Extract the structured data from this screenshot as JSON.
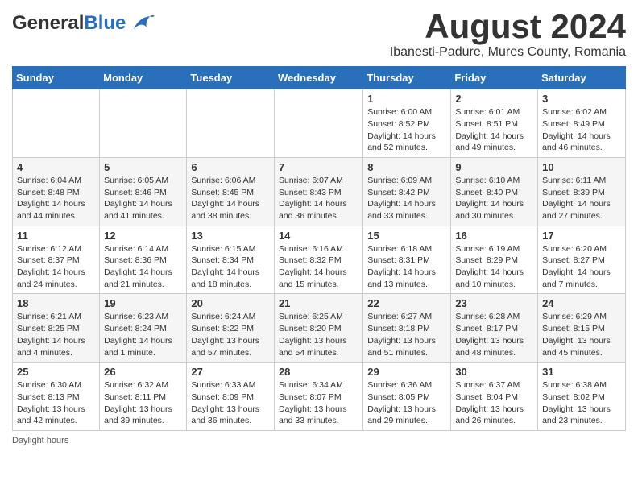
{
  "header": {
    "logo_general": "General",
    "logo_blue": "Blue",
    "month_year": "August 2024",
    "location": "Ibanesti-Padure, Mures County, Romania"
  },
  "days_of_week": [
    "Sunday",
    "Monday",
    "Tuesday",
    "Wednesday",
    "Thursday",
    "Friday",
    "Saturday"
  ],
  "weeks": [
    [
      {
        "date": "",
        "info": ""
      },
      {
        "date": "",
        "info": ""
      },
      {
        "date": "",
        "info": ""
      },
      {
        "date": "",
        "info": ""
      },
      {
        "date": "1",
        "info": "Sunrise: 6:00 AM\nSunset: 8:52 PM\nDaylight: 14 hours and 52 minutes."
      },
      {
        "date": "2",
        "info": "Sunrise: 6:01 AM\nSunset: 8:51 PM\nDaylight: 14 hours and 49 minutes."
      },
      {
        "date": "3",
        "info": "Sunrise: 6:02 AM\nSunset: 8:49 PM\nDaylight: 14 hours and 46 minutes."
      }
    ],
    [
      {
        "date": "4",
        "info": "Sunrise: 6:04 AM\nSunset: 8:48 PM\nDaylight: 14 hours and 44 minutes."
      },
      {
        "date": "5",
        "info": "Sunrise: 6:05 AM\nSunset: 8:46 PM\nDaylight: 14 hours and 41 minutes."
      },
      {
        "date": "6",
        "info": "Sunrise: 6:06 AM\nSunset: 8:45 PM\nDaylight: 14 hours and 38 minutes."
      },
      {
        "date": "7",
        "info": "Sunrise: 6:07 AM\nSunset: 8:43 PM\nDaylight: 14 hours and 36 minutes."
      },
      {
        "date": "8",
        "info": "Sunrise: 6:09 AM\nSunset: 8:42 PM\nDaylight: 14 hours and 33 minutes."
      },
      {
        "date": "9",
        "info": "Sunrise: 6:10 AM\nSunset: 8:40 PM\nDaylight: 14 hours and 30 minutes."
      },
      {
        "date": "10",
        "info": "Sunrise: 6:11 AM\nSunset: 8:39 PM\nDaylight: 14 hours and 27 minutes."
      }
    ],
    [
      {
        "date": "11",
        "info": "Sunrise: 6:12 AM\nSunset: 8:37 PM\nDaylight: 14 hours and 24 minutes."
      },
      {
        "date": "12",
        "info": "Sunrise: 6:14 AM\nSunset: 8:36 PM\nDaylight: 14 hours and 21 minutes."
      },
      {
        "date": "13",
        "info": "Sunrise: 6:15 AM\nSunset: 8:34 PM\nDaylight: 14 hours and 18 minutes."
      },
      {
        "date": "14",
        "info": "Sunrise: 6:16 AM\nSunset: 8:32 PM\nDaylight: 14 hours and 15 minutes."
      },
      {
        "date": "15",
        "info": "Sunrise: 6:18 AM\nSunset: 8:31 PM\nDaylight: 14 hours and 13 minutes."
      },
      {
        "date": "16",
        "info": "Sunrise: 6:19 AM\nSunset: 8:29 PM\nDaylight: 14 hours and 10 minutes."
      },
      {
        "date": "17",
        "info": "Sunrise: 6:20 AM\nSunset: 8:27 PM\nDaylight: 14 hours and 7 minutes."
      }
    ],
    [
      {
        "date": "18",
        "info": "Sunrise: 6:21 AM\nSunset: 8:25 PM\nDaylight: 14 hours and 4 minutes."
      },
      {
        "date": "19",
        "info": "Sunrise: 6:23 AM\nSunset: 8:24 PM\nDaylight: 14 hours and 1 minute."
      },
      {
        "date": "20",
        "info": "Sunrise: 6:24 AM\nSunset: 8:22 PM\nDaylight: 13 hours and 57 minutes."
      },
      {
        "date": "21",
        "info": "Sunrise: 6:25 AM\nSunset: 8:20 PM\nDaylight: 13 hours and 54 minutes."
      },
      {
        "date": "22",
        "info": "Sunrise: 6:27 AM\nSunset: 8:18 PM\nDaylight: 13 hours and 51 minutes."
      },
      {
        "date": "23",
        "info": "Sunrise: 6:28 AM\nSunset: 8:17 PM\nDaylight: 13 hours and 48 minutes."
      },
      {
        "date": "24",
        "info": "Sunrise: 6:29 AM\nSunset: 8:15 PM\nDaylight: 13 hours and 45 minutes."
      }
    ],
    [
      {
        "date": "25",
        "info": "Sunrise: 6:30 AM\nSunset: 8:13 PM\nDaylight: 13 hours and 42 minutes."
      },
      {
        "date": "26",
        "info": "Sunrise: 6:32 AM\nSunset: 8:11 PM\nDaylight: 13 hours and 39 minutes."
      },
      {
        "date": "27",
        "info": "Sunrise: 6:33 AM\nSunset: 8:09 PM\nDaylight: 13 hours and 36 minutes."
      },
      {
        "date": "28",
        "info": "Sunrise: 6:34 AM\nSunset: 8:07 PM\nDaylight: 13 hours and 33 minutes."
      },
      {
        "date": "29",
        "info": "Sunrise: 6:36 AM\nSunset: 8:05 PM\nDaylight: 13 hours and 29 minutes."
      },
      {
        "date": "30",
        "info": "Sunrise: 6:37 AM\nSunset: 8:04 PM\nDaylight: 13 hours and 26 minutes."
      },
      {
        "date": "31",
        "info": "Sunrise: 6:38 AM\nSunset: 8:02 PM\nDaylight: 13 hours and 23 minutes."
      }
    ]
  ],
  "footer": {
    "daylight_label": "Daylight hours"
  }
}
